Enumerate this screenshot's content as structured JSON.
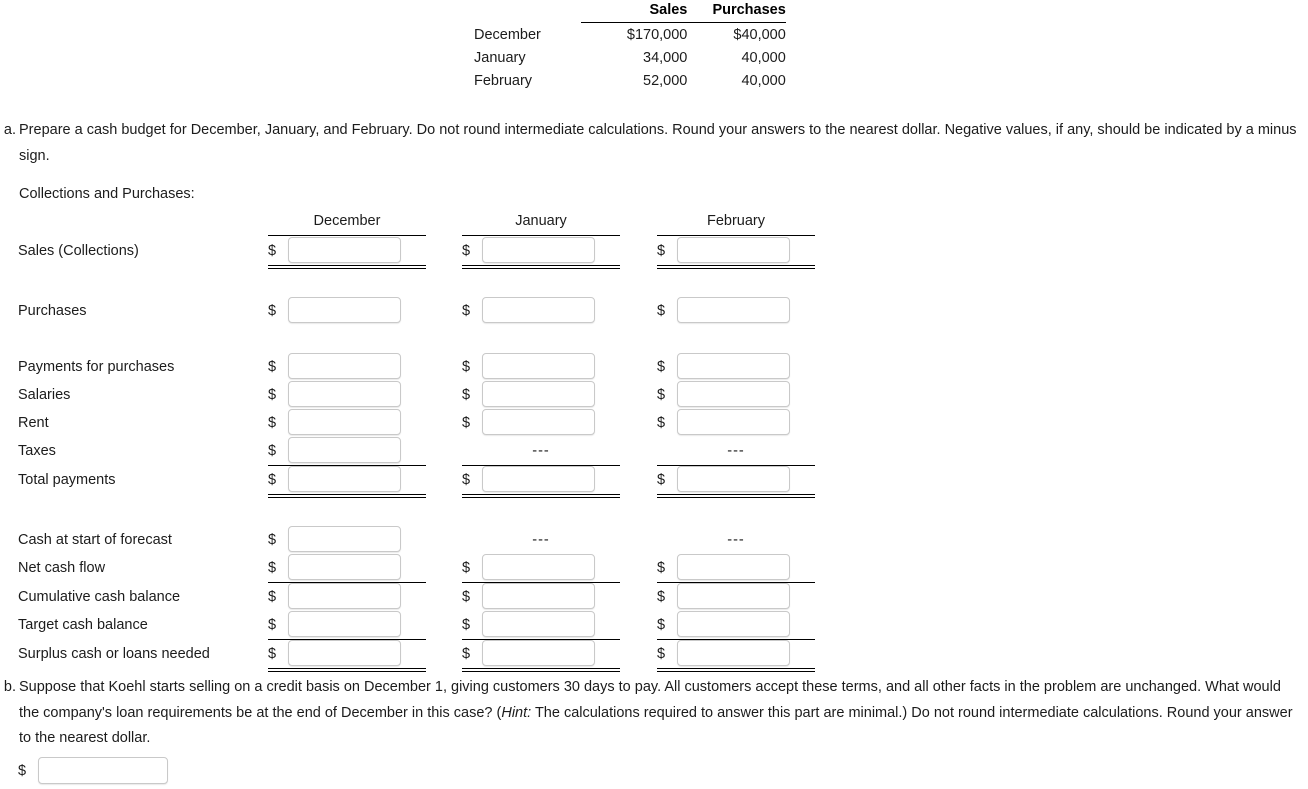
{
  "given_table": {
    "columns": [
      "",
      "Sales",
      "Purchases"
    ],
    "rows": [
      {
        "month": "December",
        "sales": "$170,000",
        "purchases": "$40,000"
      },
      {
        "month": "January",
        "sales": "34,000",
        "purchases": "40,000"
      },
      {
        "month": "February",
        "sales": "52,000",
        "purchases": "40,000"
      }
    ]
  },
  "questions": {
    "a": {
      "label": "a.",
      "text": "Prepare a cash budget for December, January, and February. Do not round intermediate calculations. Round your answers to the nearest dollar. Negative values, if any, should be indicated by a minus sign."
    },
    "b": {
      "label": "b.",
      "text_1": "Suppose that Koehl starts selling on a credit basis on December 1, giving customers 30 days to pay. All customers accept these terms, and all other facts in the problem are unchanged. What would the company's loan requirements be at the end of December in this case? (",
      "hint_label": "Hint:",
      "text_2": " The calculations required to answer this part are minimal.) Do not round intermediate calculations. Round your answer to the nearest dollar."
    }
  },
  "section_heading": "Collections and Purchases:",
  "months": [
    "December",
    "January",
    "February"
  ],
  "currency_symbol": "$",
  "dash_placeholder": "---",
  "budget_rows": [
    {
      "id": "sales-collections",
      "label": "Sales (Collections)",
      "cells": [
        "input",
        "input",
        "input"
      ],
      "values": [
        "",
        "",
        ""
      ]
    },
    {
      "id": "purchases",
      "label": "Purchases",
      "cells": [
        "input",
        "input",
        "input"
      ],
      "values": [
        "",
        "",
        ""
      ]
    },
    {
      "id": "payments-for-purchases",
      "label": "Payments for purchases",
      "cells": [
        "input",
        "input",
        "input"
      ],
      "values": [
        "",
        "",
        ""
      ]
    },
    {
      "id": "salaries",
      "label": "Salaries",
      "cells": [
        "input",
        "input",
        "input"
      ],
      "values": [
        "",
        "",
        ""
      ]
    },
    {
      "id": "rent",
      "label": "Rent",
      "cells": [
        "input",
        "input",
        "input"
      ],
      "values": [
        "",
        "",
        ""
      ]
    },
    {
      "id": "taxes",
      "label": "Taxes",
      "cells": [
        "input",
        "dash",
        "dash"
      ],
      "values": [
        "",
        "",
        ""
      ]
    },
    {
      "id": "total-payments",
      "label": "Total payments",
      "cells": [
        "input",
        "input",
        "input"
      ],
      "values": [
        "",
        "",
        ""
      ]
    },
    {
      "id": "cash-at-start",
      "label": "Cash at start of forecast",
      "cells": [
        "input",
        "dash",
        "dash"
      ],
      "values": [
        "",
        "",
        ""
      ]
    },
    {
      "id": "net-cash-flow",
      "label": "Net cash flow",
      "cells": [
        "input",
        "input",
        "input"
      ],
      "values": [
        "",
        "",
        ""
      ]
    },
    {
      "id": "cumulative-cash-balance",
      "label": "Cumulative cash balance",
      "cells": [
        "input",
        "input",
        "input"
      ],
      "values": [
        "",
        "",
        ""
      ]
    },
    {
      "id": "target-cash-balance",
      "label": "Target cash balance",
      "cells": [
        "input",
        "input",
        "input"
      ],
      "values": [
        "",
        "",
        ""
      ]
    },
    {
      "id": "surplus-or-loans",
      "label": "Surplus cash or loans needed",
      "cells": [
        "input",
        "input",
        "input"
      ],
      "values": [
        "",
        "",
        ""
      ]
    }
  ],
  "answer_b": {
    "currency_symbol": "$",
    "value": ""
  },
  "colors": {
    "text": "#1c1c1c",
    "rule": "#000000",
    "input_border": "#c9c9c9",
    "background": "#ffffff"
  }
}
